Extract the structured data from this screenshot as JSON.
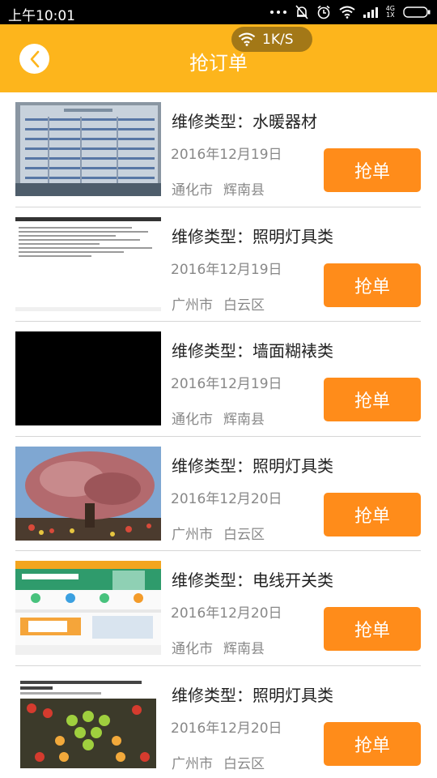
{
  "status_bar": {
    "time": "上午10:01",
    "network_label_top": "4G",
    "network_label_bottom": "1X"
  },
  "header": {
    "title": "抢订单",
    "speed": "1K/S",
    "background_color": "#fdb51c"
  },
  "type_label": "维修类型：",
  "grab_button_color": "#ff8c1a",
  "orders": [
    {
      "type": "水暖器材",
      "date": "2016年12月19日",
      "city": "通化市",
      "district": "辉南县",
      "button": "抢单",
      "thumb": "document-table-photo"
    },
    {
      "type": "照明灯具类",
      "date": "2016年12月19日",
      "city": "广州市",
      "district": "白云区",
      "button": "抢单",
      "thumb": "text-screenshot"
    },
    {
      "type": "墙面糊裱类",
      "date": "2016年12月19日",
      "city": "通化市",
      "district": "辉南县",
      "button": "抢单",
      "thumb": "black-image"
    },
    {
      "type": "照明灯具类",
      "date": "2016年12月20日",
      "city": "广州市",
      "district": "白云区",
      "button": "抢单",
      "thumb": "decorated-tree-photo"
    },
    {
      "type": "电线开关类",
      "date": "2016年12月20日",
      "city": "通化市",
      "district": "辉南县",
      "button": "抢单",
      "thumb": "app-screenshot"
    },
    {
      "type": "照明灯具类",
      "date": "2016年12月20日",
      "city": "广州市",
      "district": "白云区",
      "button": "抢单",
      "thumb": "fruit-display-photo"
    }
  ]
}
